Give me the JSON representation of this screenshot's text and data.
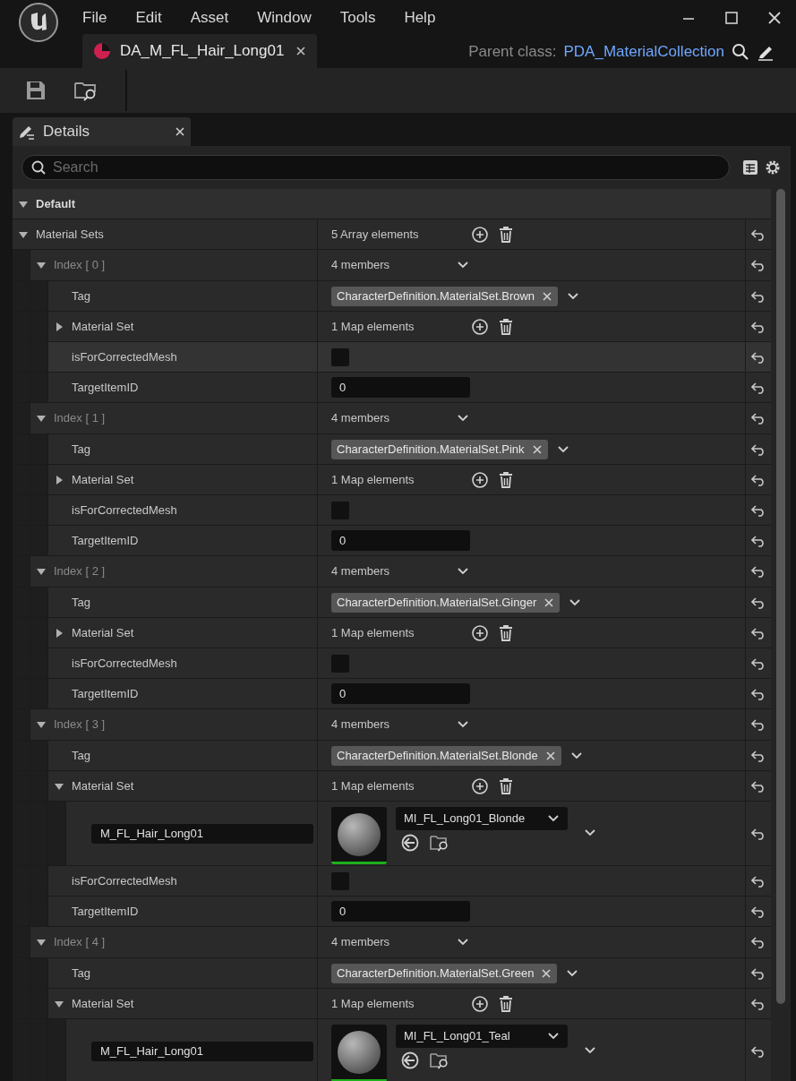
{
  "window": {
    "menu": [
      "File",
      "Edit",
      "Asset",
      "Window",
      "Tools",
      "Help"
    ],
    "asset_tab": "DA_M_FL_Hair_Long01",
    "parent_class_label": "Parent class:",
    "parent_class": "PDA_MaterialCollection"
  },
  "details": {
    "title": "Details",
    "search": {
      "placeholder": "Search"
    },
    "category": {
      "label": "Default",
      "expanded": true
    },
    "array": {
      "label": "Material Sets",
      "value": "5 Array elements",
      "expanded": true
    },
    "elements": [
      {
        "label": "Index [ 0 ]",
        "value": "4 members",
        "expanded": true,
        "properties": [
          {
            "kind": "tag",
            "label": "Tag",
            "value": "CharacterDefinition.MaterialSet.Brown"
          },
          {
            "kind": "map",
            "label": "Material Set",
            "value": "1 Map elements",
            "expanded": false
          },
          {
            "kind": "checkbox",
            "label": "isForCorrectedMesh",
            "checked": false,
            "hovered": true
          },
          {
            "kind": "number",
            "label": "TargetItemID",
            "value": "0"
          }
        ]
      },
      {
        "label": "Index [ 1 ]",
        "value": "4 members",
        "expanded": true,
        "properties": [
          {
            "kind": "tag",
            "label": "Tag",
            "value": "CharacterDefinition.MaterialSet.Pink"
          },
          {
            "kind": "map",
            "label": "Material Set",
            "value": "1 Map elements",
            "expanded": false
          },
          {
            "kind": "checkbox",
            "label": "isForCorrectedMesh",
            "checked": false,
            "hovered": false
          },
          {
            "kind": "number",
            "label": "TargetItemID",
            "value": "0"
          }
        ]
      },
      {
        "label": "Index [ 2 ]",
        "value": "4 members",
        "expanded": true,
        "properties": [
          {
            "kind": "tag",
            "label": "Tag",
            "value": "CharacterDefinition.MaterialSet.Ginger"
          },
          {
            "kind": "map",
            "label": "Material Set",
            "value": "1 Map elements",
            "expanded": false
          },
          {
            "kind": "checkbox",
            "label": "isForCorrectedMesh",
            "checked": false,
            "hovered": false
          },
          {
            "kind": "number",
            "label": "TargetItemID",
            "value": "0"
          }
        ]
      },
      {
        "label": "Index [ 3 ]",
        "value": "4 members",
        "expanded": true,
        "properties": [
          {
            "kind": "tag",
            "label": "Tag",
            "value": "CharacterDefinition.MaterialSet.Blonde"
          },
          {
            "kind": "map",
            "label": "Material Set",
            "value": "1 Map elements",
            "expanded": true,
            "entries": [
              {
                "key": "M_FL_Hair_Long01",
                "material": "MI_FL_Long01_Blonde"
              }
            ]
          },
          {
            "kind": "checkbox",
            "label": "isForCorrectedMesh",
            "checked": false,
            "hovered": false
          },
          {
            "kind": "number",
            "label": "TargetItemID",
            "value": "0"
          }
        ]
      },
      {
        "label": "Index [ 4 ]",
        "value": "4 members",
        "expanded": true,
        "properties": [
          {
            "kind": "tag",
            "label": "Tag",
            "value": "CharacterDefinition.MaterialSet.Green"
          },
          {
            "kind": "map",
            "label": "Material Set",
            "value": "1 Map elements",
            "expanded": true,
            "entries": [
              {
                "key": "M_FL_Hair_Long01",
                "material": "MI_FL_Long01_Teal"
              }
            ]
          }
        ]
      }
    ]
  }
}
